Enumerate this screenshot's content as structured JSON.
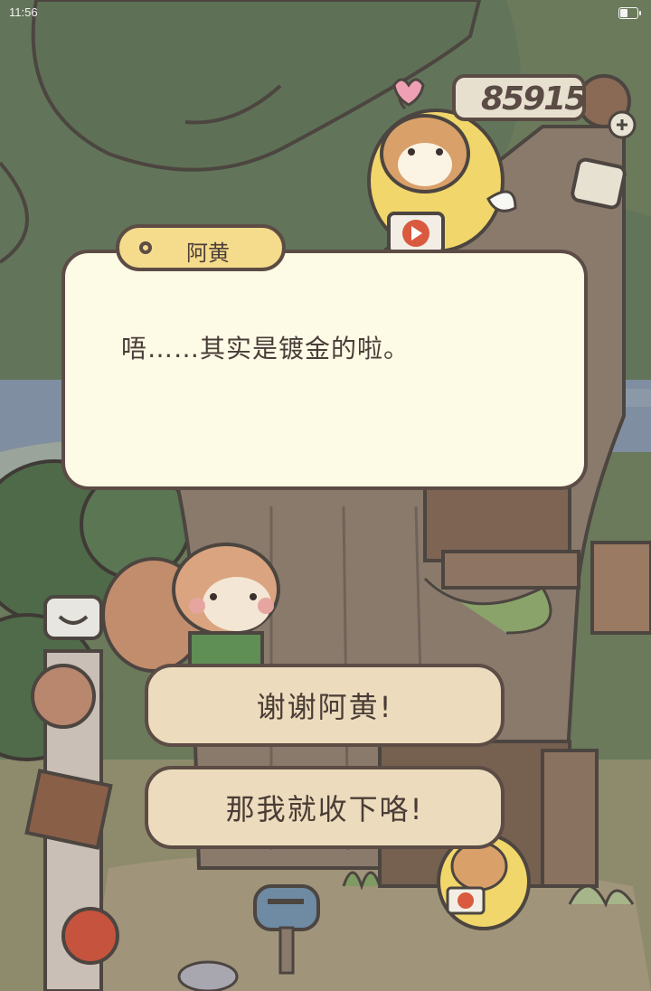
{
  "status_bar": {
    "time": "11:56",
    "battery_level": 0.45
  },
  "currency": {
    "coins": "85915"
  },
  "dialog": {
    "speaker": "阿黄",
    "text": "唔……其实是镀金的啦。"
  },
  "choices": [
    {
      "label": "谢谢阿黄!"
    },
    {
      "label": "那我就收下咯!"
    }
  ],
  "colors": {
    "dialog_bg": "#fdfbe6",
    "name_tag_bg": "#f4dc8c",
    "choice_bg": "#ecdcbd",
    "outline": "#5c4c45",
    "tree_green": "#5f7456"
  }
}
